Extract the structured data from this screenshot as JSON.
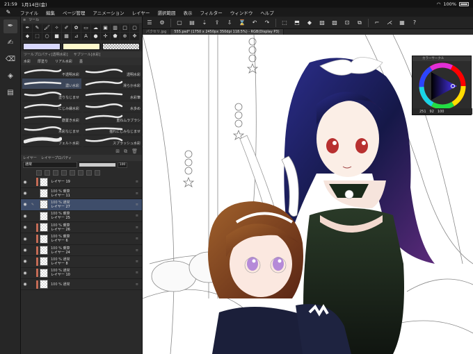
{
  "status": {
    "time": "21:59",
    "date": "1月14日(金)",
    "battery": "100%"
  },
  "menu": {
    "items": [
      "ファイル",
      "編集",
      "ページ管理",
      "アニメーション",
      "レイヤー",
      "選択範囲",
      "表示",
      "フィルター",
      "ウィンドウ",
      "ヘルプ"
    ]
  },
  "tabs": [
    {
      "label": "パクセリ.jpg",
      "active": false
    },
    {
      "label": "555.psd* (1750 x 2450px 350dpi 118.5%) - RGB(Display P3)",
      "active": true
    }
  ],
  "tool_panel": {
    "title": "ツール"
  },
  "subtool_panel": {
    "head_labels": [
      "ツールプロパティ[透明水彩]",
      "サブツール[水彩]"
    ],
    "tabs": [
      "水彩",
      "厚塗り",
      "リアル水彩",
      "墨"
    ],
    "brushes": [
      {
        "label": "不透明水彩",
        "selected": false
      },
      {
        "label": "透明水彩",
        "selected": false
      },
      {
        "label": "濃い水彩",
        "selected": true
      },
      {
        "label": "滑らか水彩",
        "selected": false
      },
      {
        "label": "塗りなじませ",
        "selected": false
      },
      {
        "label": "水彩筆",
        "selected": false
      },
      {
        "label": "にじみ縁水彩",
        "selected": false
      },
      {
        "label": "水多め",
        "selected": false
      },
      {
        "label": "筋置き水彩",
        "selected": false
      },
      {
        "label": "重ねムラブラシ",
        "selected": false
      },
      {
        "label": "水彩なじませ",
        "selected": false
      },
      {
        "label": "揺れにじみなじませ",
        "selected": false
      },
      {
        "label": "フェルト水彩",
        "selected": false
      },
      {
        "label": "スプラッシュ水彩",
        "selected": false
      }
    ]
  },
  "layer_panel": {
    "head_labels": [
      "レイヤー",
      "レイヤープロパティ"
    ],
    "blend_mode": "通常",
    "opacity": "100",
    "opacity_fraction": 1.0,
    "layers": [
      {
        "line1": "",
        "line2": "レイヤー 19",
        "selected": false,
        "tag": true
      },
      {
        "line1": "100 % 乗算",
        "line2": "レイヤー 11",
        "selected": false,
        "tag": false
      },
      {
        "line1": "100 % 通常",
        "line2": "レイヤー 27",
        "selected": true,
        "tag": false
      },
      {
        "line1": "100 % 乗算",
        "line2": "レイヤー 25",
        "selected": false,
        "tag": false
      },
      {
        "line1": "100 % 乗算",
        "line2": "レイヤー 26",
        "selected": false,
        "tag": true
      },
      {
        "line1": "100 % 乗算",
        "line2": "レイヤー 6",
        "selected": false,
        "tag": true
      },
      {
        "line1": "100 % 乗算",
        "line2": "レイヤー 24",
        "selected": false,
        "tag": true
      },
      {
        "line1": "100 % 通常",
        "line2": "レイヤー 8",
        "selected": false,
        "tag": true
      },
      {
        "line1": "100 % 通常",
        "line2": "レイヤー 10",
        "selected": false,
        "tag": true
      },
      {
        "line1": "100 % 通常",
        "line2": "",
        "selected": false,
        "tag": true
      }
    ]
  },
  "color_wheel": {
    "title": "カラーサークル",
    "h": "251",
    "s": "92",
    "v": "100"
  },
  "colors": {
    "main_color": "#d9d9ff",
    "sub_color": "#fffacc",
    "hair_main": "#1d1f6b",
    "hair_child": "#7a3a1c",
    "dress": "#1f2a1f",
    "accent_layer_tag": "#c46b55",
    "selected_row": "#3e4d6a"
  }
}
